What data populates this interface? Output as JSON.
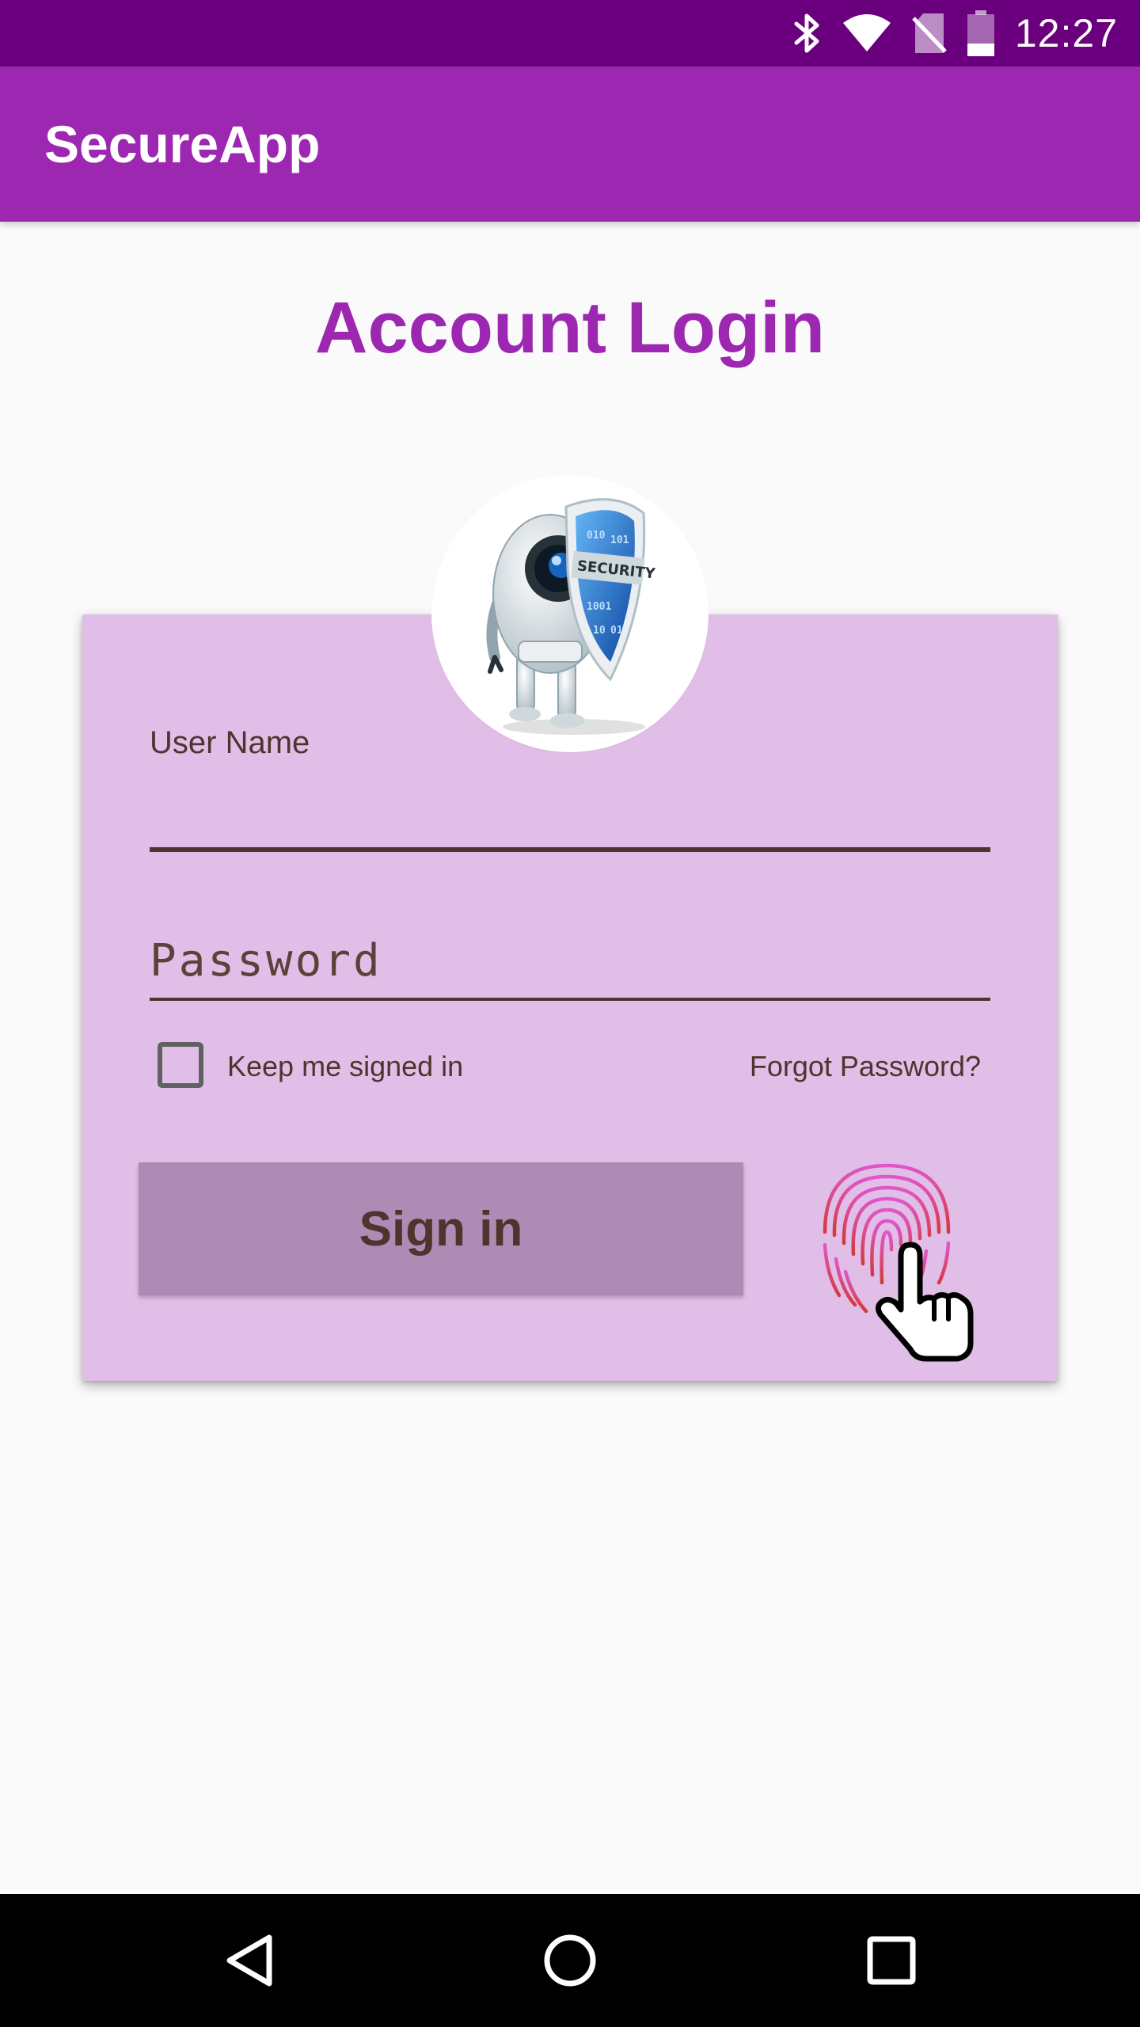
{
  "status_bar": {
    "time": "12:27",
    "icons": [
      "bluetooth-icon",
      "wifi-icon",
      "no-sim-icon",
      "battery-icon"
    ]
  },
  "app_bar": {
    "title": "SecureApp"
  },
  "page": {
    "heading": "Account Login"
  },
  "login_form": {
    "avatar_icon": "security-robot-icon",
    "avatar_text": "SECURITY",
    "username_label": "User Name",
    "username_value": "",
    "password_placeholder": "Password",
    "password_value": "",
    "keep_signed_in_label": "Keep me signed in",
    "keep_signed_in_checked": false,
    "forgot_password_label": "Forgot Password?",
    "signin_label": "Sign in",
    "fingerprint_icon": "fingerprint-icon"
  },
  "nav_bar": {
    "icons": [
      "back-icon",
      "home-icon",
      "recents-icon"
    ]
  },
  "colors": {
    "status_bar": "#6a007d",
    "primary": "#9c27b0",
    "card_background": "#e1bee7",
    "button_background": "#ae8bb4",
    "text_brown": "#4e342e"
  }
}
